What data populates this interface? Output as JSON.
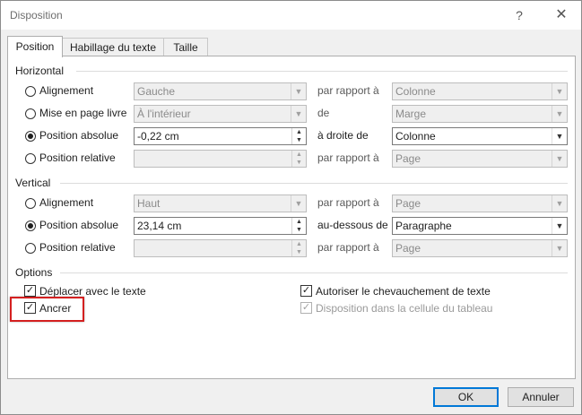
{
  "window": {
    "title": "Disposition",
    "help": "?",
    "close": "✕"
  },
  "tabs": [
    {
      "label": "Position"
    },
    {
      "label": "Habillage du texte"
    },
    {
      "label": "Taille"
    }
  ],
  "horizontal": {
    "title": "Horizontal",
    "rows": [
      {
        "label": "Alignement",
        "checked": false,
        "value": "Gauche",
        "relation": "par rapport à",
        "target": "Colonne"
      },
      {
        "label": "Mise en page livre",
        "checked": false,
        "value": "À l'intérieur",
        "relation": "de",
        "target": "Marge"
      },
      {
        "label": "Position absolue",
        "checked": true,
        "value": "-0,22 cm",
        "relation": "à droite de",
        "target": "Colonne"
      },
      {
        "label": "Position relative",
        "checked": false,
        "value": "",
        "relation": "par rapport à",
        "target": "Page"
      }
    ]
  },
  "vertical": {
    "title": "Vertical",
    "rows": [
      {
        "label": "Alignement",
        "checked": false,
        "value": "Haut",
        "relation": "par rapport à",
        "target": "Page"
      },
      {
        "label": "Position absolue",
        "checked": true,
        "value": "23,14 cm",
        "relation": "au-dessous de",
        "target": "Paragraphe"
      },
      {
        "label": "Position relative",
        "checked": false,
        "value": "",
        "relation": "par rapport à",
        "target": "Page"
      }
    ]
  },
  "options": {
    "title": "Options",
    "move_with_text": "Déplacer avec le texte",
    "anchor": "Ancrer",
    "allow_overlap": "Autoriser le chevauchement de texte",
    "layout_in_cell": "Disposition dans la cellule du tableau"
  },
  "buttons": {
    "ok": "OK",
    "cancel": "Annuler"
  },
  "colors": {
    "highlight": "#d42020",
    "default_button_border": "#0078d7"
  }
}
